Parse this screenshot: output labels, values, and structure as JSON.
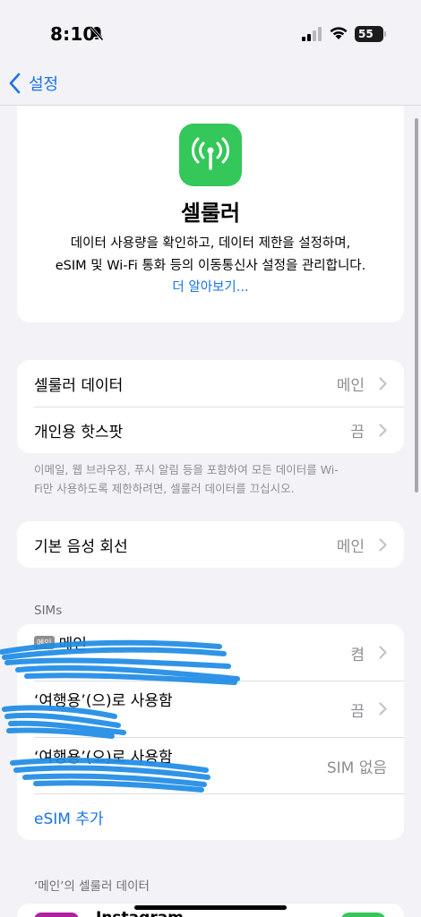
{
  "status": {
    "time": "8:10",
    "battery": "55"
  },
  "nav": {
    "back_label": "설정"
  },
  "hero": {
    "title": "셀룰러",
    "desc_line1": "데이터 사용량을 확인하고, 데이터 제한을 설정하며,",
    "desc_line2": "eSIM 및 Wi-Fi 통화 등의 이동통신사 설정을 관리합니다.",
    "link": "더 알아보기..."
  },
  "data_group": {
    "rows": [
      {
        "label": "셀룰러 데이터",
        "value": "메인"
      },
      {
        "label": "개인용 핫스팟",
        "value": "끔"
      }
    ],
    "footnote_line1": "이메일, 웹 브라우징, 푸시 알림 등을 포함하여 모든 데이터를 Wi-",
    "footnote_line2": "Fi만 사용하도록 제한하려면, 셀룰러 데이터를 끄십시오."
  },
  "voice": {
    "label": "기본 음성 회선",
    "value": "메인"
  },
  "sims": {
    "header": "SIMs",
    "items": [
      {
        "badge": "메인",
        "title": "메인",
        "value": "켬"
      },
      {
        "title": "‘여행용’(으)로 사용함",
        "value": "끔"
      },
      {
        "title": "‘여행용’(으)로 사용함",
        "value": "SIM 없음"
      }
    ],
    "add_label": "eSIM 추가"
  },
  "usage": {
    "header": "‘메인’의 셀룰러 데이터",
    "first_app": "Instagram"
  },
  "colors": {
    "accent": "#1a73e8",
    "green": "#34c759",
    "scribble": "#1e8ce6"
  }
}
